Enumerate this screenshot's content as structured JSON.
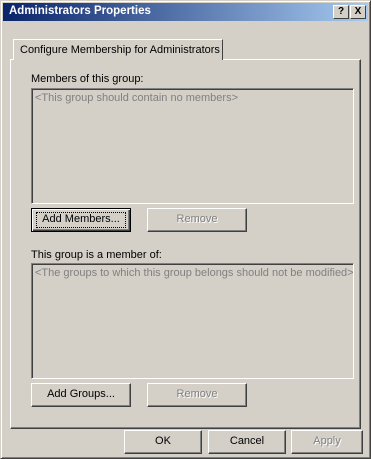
{
  "window": {
    "title": "Administrators Properties",
    "help_label": "?",
    "close_label": "X"
  },
  "tabs": [
    {
      "label": "Configure Membership for Administrators"
    }
  ],
  "members_section": {
    "label": "Members of this group:",
    "list_placeholder": "<This group should contain no members>",
    "add_button": "Add Members...",
    "remove_button": "Remove"
  },
  "member_of_section": {
    "label": "This group is a member of:",
    "list_placeholder": "<The groups to which this group belongs should not be modified>",
    "add_button": "Add Groups...",
    "remove_button": "Remove"
  },
  "footer": {
    "ok_button": "OK",
    "cancel_button": "Cancel",
    "apply_button": "Apply"
  },
  "colors": {
    "face": "#d4d0c8",
    "title_start": "#0a246a",
    "title_end": "#a6caf0",
    "disabled_text": "#808080"
  }
}
